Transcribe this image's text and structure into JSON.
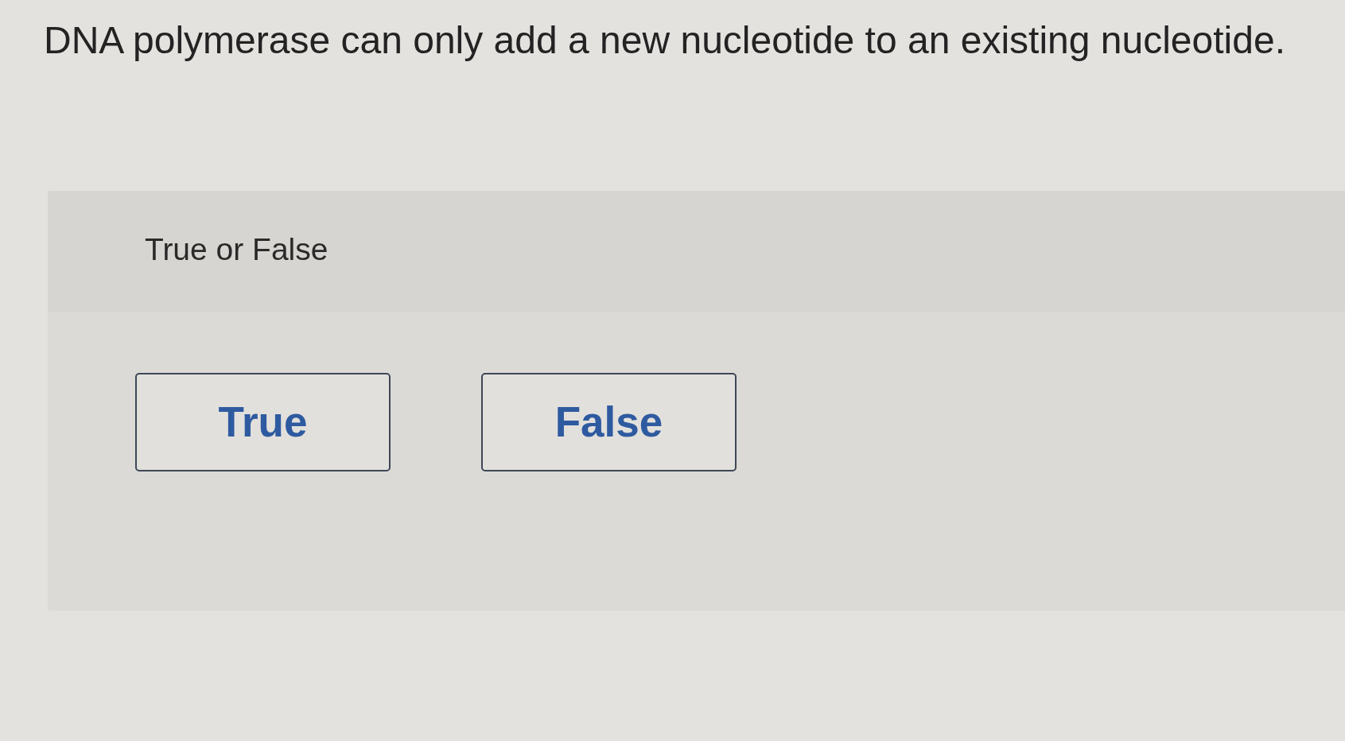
{
  "question": {
    "text": "DNA polymerase can only add a new nucleotide to an existing nucleotide."
  },
  "answer_panel": {
    "prompt": "True or False",
    "options": [
      {
        "label": "True",
        "selected": false
      },
      {
        "label": "False",
        "selected": false
      }
    ]
  }
}
